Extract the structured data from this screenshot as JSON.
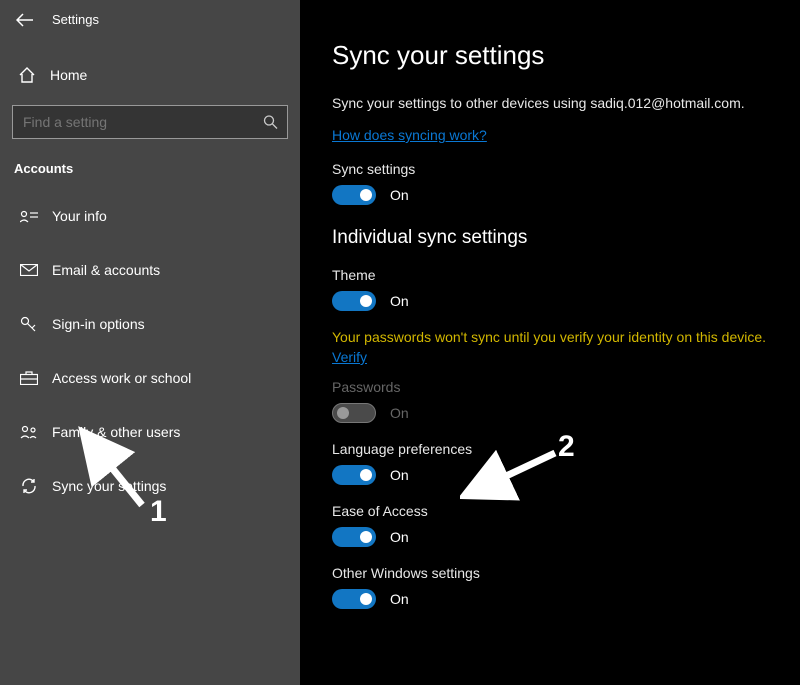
{
  "header": {
    "title": "Settings"
  },
  "home": {
    "label": "Home"
  },
  "search": {
    "placeholder": "Find a setting"
  },
  "section": {
    "label": "Accounts"
  },
  "nav": {
    "items": [
      {
        "label": "Your info"
      },
      {
        "label": "Email & accounts"
      },
      {
        "label": "Sign-in options"
      },
      {
        "label": "Access work or school"
      },
      {
        "label": "Family & other users"
      },
      {
        "label": "Sync your settings"
      }
    ]
  },
  "main": {
    "title": "Sync your settings",
    "description": "Sync your settings to other devices using sadiq.012@hotmail.com.",
    "link": "How does syncing work?",
    "sync_settings_label": "Sync settings",
    "on": "On",
    "sub_title": "Individual sync settings",
    "theme_label": "Theme",
    "warning": "Your passwords won't sync until you verify your identity on this device.",
    "verify": "Verify",
    "passwords_label": "Passwords",
    "lang_label": "Language preferences",
    "ease_label": "Ease of Access",
    "other_label": "Other Windows settings"
  },
  "annotations": {
    "one": "1",
    "two": "2"
  }
}
